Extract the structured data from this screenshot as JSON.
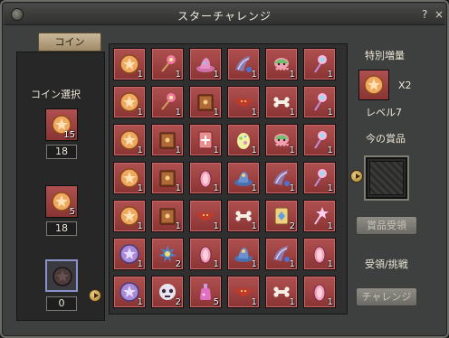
{
  "window": {
    "title": "スターチャレンジ",
    "help": "?",
    "close": "×"
  },
  "tabs": {
    "coin": "コイン"
  },
  "left": {
    "label": "コイン選択",
    "coins": [
      {
        "icon": "orange-star-coin-icon",
        "stack": "15",
        "count": "18"
      },
      {
        "icon": "orange-star-coin-icon",
        "stack": "5",
        "count": "18"
      },
      {
        "icon": "dark-coin-icon",
        "stack": "",
        "count": "0"
      }
    ]
  },
  "grid": {
    "rows": [
      [
        {
          "icon": "orange-star-coin-icon",
          "qty": "1"
        },
        {
          "icon": "flower-wand-icon",
          "qty": "1"
        },
        {
          "icon": "pink-hat-icon",
          "qty": "1"
        },
        {
          "icon": "feather-wings-icon",
          "qty": "1"
        },
        {
          "icon": "octopus-doll-icon",
          "qty": "1"
        },
        {
          "icon": "candy-wand-icon",
          "qty": "1"
        }
      ],
      [
        {
          "icon": "orange-star-coin-icon",
          "qty": "1"
        },
        {
          "icon": "flower-wand-icon",
          "qty": "1"
        },
        {
          "icon": "brown-book-icon",
          "qty": "1"
        },
        {
          "icon": "red-bat-icon",
          "qty": "1"
        },
        {
          "icon": "bone-icon",
          "qty": "1"
        },
        {
          "icon": "candy-wand-icon",
          "qty": "1"
        }
      ],
      [
        {
          "icon": "orange-star-coin-icon",
          "qty": "1"
        },
        {
          "icon": "brown-book-icon",
          "qty": "1"
        },
        {
          "icon": "plus-card-icon",
          "qty": "1"
        },
        {
          "icon": "egg-icon",
          "qty": "1"
        },
        {
          "icon": "octopus-doll-icon",
          "qty": "1"
        },
        {
          "icon": "candy-wand-icon",
          "qty": "1"
        }
      ],
      [
        {
          "icon": "orange-star-coin-icon",
          "qty": "1"
        },
        {
          "icon": "brown-book-icon",
          "qty": "1"
        },
        {
          "icon": "pink-sandal-icon",
          "qty": "1"
        },
        {
          "icon": "blue-hat-icon",
          "qty": "1"
        },
        {
          "icon": "feather-wings-icon",
          "qty": "1"
        },
        {
          "icon": "candy-wand-icon",
          "qty": "1"
        }
      ],
      [
        {
          "icon": "orange-star-coin-icon",
          "qty": "1"
        },
        {
          "icon": "brown-book-icon",
          "qty": "1"
        },
        {
          "icon": "red-bat-icon",
          "qty": "1"
        },
        {
          "icon": "bone-icon",
          "qty": "1"
        },
        {
          "icon": "gem-card-icon",
          "qty": "2"
        },
        {
          "icon": "sparkle-wand-icon",
          "qty": "1"
        }
      ],
      [
        {
          "icon": "purple-star-coin-icon",
          "qty": "1"
        },
        {
          "icon": "blue-badge-icon",
          "qty": "2"
        },
        {
          "icon": "pink-sandal-icon",
          "qty": "1"
        },
        {
          "icon": "blue-hat-icon",
          "qty": "1"
        },
        {
          "icon": "feather-wings-icon",
          "qty": "1"
        },
        {
          "icon": "pink-sandal-icon",
          "qty": "1"
        }
      ],
      [
        {
          "icon": "purple-star-coin-icon",
          "qty": "1"
        },
        {
          "icon": "skull-mask-icon",
          "qty": "2"
        },
        {
          "icon": "potion-icon",
          "qty": "5"
        },
        {
          "icon": "red-bat-icon",
          "qty": "1"
        },
        {
          "icon": "bone-icon",
          "qty": "1"
        },
        {
          "icon": "pink-sandal-icon",
          "qty": "1"
        }
      ]
    ]
  },
  "right": {
    "bonus_label": "特別増量",
    "bonus_icon": "orange-star-coin-icon",
    "multiplier": "X2",
    "level": "レベル7",
    "prize_label": "今の賞品",
    "receive_button": "賞品受領",
    "receive_challenge_label": "受領/挑戦",
    "challenge_button": "チャレンジ"
  }
}
